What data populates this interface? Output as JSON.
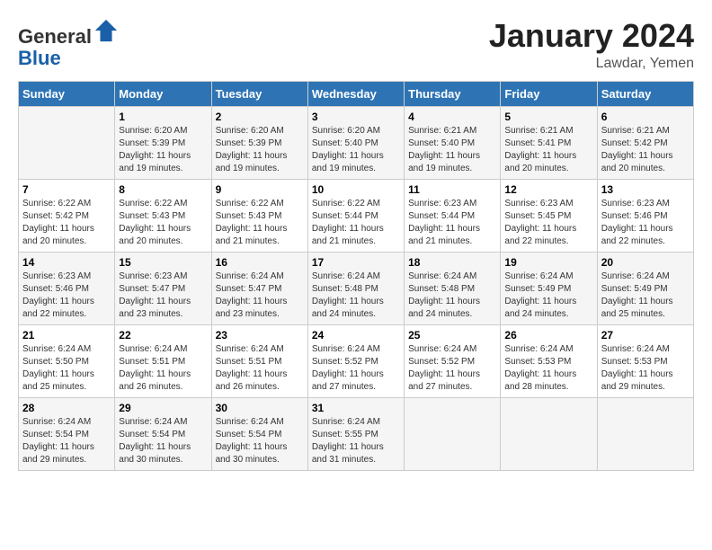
{
  "header": {
    "logo_line1": "General",
    "logo_line2": "Blue",
    "month": "January 2024",
    "location": "Lawdar, Yemen"
  },
  "weekdays": [
    "Sunday",
    "Monday",
    "Tuesday",
    "Wednesday",
    "Thursday",
    "Friday",
    "Saturday"
  ],
  "weeks": [
    [
      {
        "day": "",
        "info": ""
      },
      {
        "day": "1",
        "info": "Sunrise: 6:20 AM\nSunset: 5:39 PM\nDaylight: 11 hours and 19 minutes."
      },
      {
        "day": "2",
        "info": "Sunrise: 6:20 AM\nSunset: 5:39 PM\nDaylight: 11 hours and 19 minutes."
      },
      {
        "day": "3",
        "info": "Sunrise: 6:20 AM\nSunset: 5:40 PM\nDaylight: 11 hours and 19 minutes."
      },
      {
        "day": "4",
        "info": "Sunrise: 6:21 AM\nSunset: 5:40 PM\nDaylight: 11 hours and 19 minutes."
      },
      {
        "day": "5",
        "info": "Sunrise: 6:21 AM\nSunset: 5:41 PM\nDaylight: 11 hours and 20 minutes."
      },
      {
        "day": "6",
        "info": "Sunrise: 6:21 AM\nSunset: 5:42 PM\nDaylight: 11 hours and 20 minutes."
      }
    ],
    [
      {
        "day": "7",
        "info": "Sunrise: 6:22 AM\nSunset: 5:42 PM\nDaylight: 11 hours and 20 minutes."
      },
      {
        "day": "8",
        "info": "Sunrise: 6:22 AM\nSunset: 5:43 PM\nDaylight: 11 hours and 20 minutes."
      },
      {
        "day": "9",
        "info": "Sunrise: 6:22 AM\nSunset: 5:43 PM\nDaylight: 11 hours and 21 minutes."
      },
      {
        "day": "10",
        "info": "Sunrise: 6:22 AM\nSunset: 5:44 PM\nDaylight: 11 hours and 21 minutes."
      },
      {
        "day": "11",
        "info": "Sunrise: 6:23 AM\nSunset: 5:44 PM\nDaylight: 11 hours and 21 minutes."
      },
      {
        "day": "12",
        "info": "Sunrise: 6:23 AM\nSunset: 5:45 PM\nDaylight: 11 hours and 22 minutes."
      },
      {
        "day": "13",
        "info": "Sunrise: 6:23 AM\nSunset: 5:46 PM\nDaylight: 11 hours and 22 minutes."
      }
    ],
    [
      {
        "day": "14",
        "info": "Sunrise: 6:23 AM\nSunset: 5:46 PM\nDaylight: 11 hours and 22 minutes."
      },
      {
        "day": "15",
        "info": "Sunrise: 6:23 AM\nSunset: 5:47 PM\nDaylight: 11 hours and 23 minutes."
      },
      {
        "day": "16",
        "info": "Sunrise: 6:24 AM\nSunset: 5:47 PM\nDaylight: 11 hours and 23 minutes."
      },
      {
        "day": "17",
        "info": "Sunrise: 6:24 AM\nSunset: 5:48 PM\nDaylight: 11 hours and 24 minutes."
      },
      {
        "day": "18",
        "info": "Sunrise: 6:24 AM\nSunset: 5:48 PM\nDaylight: 11 hours and 24 minutes."
      },
      {
        "day": "19",
        "info": "Sunrise: 6:24 AM\nSunset: 5:49 PM\nDaylight: 11 hours and 24 minutes."
      },
      {
        "day": "20",
        "info": "Sunrise: 6:24 AM\nSunset: 5:49 PM\nDaylight: 11 hours and 25 minutes."
      }
    ],
    [
      {
        "day": "21",
        "info": "Sunrise: 6:24 AM\nSunset: 5:50 PM\nDaylight: 11 hours and 25 minutes."
      },
      {
        "day": "22",
        "info": "Sunrise: 6:24 AM\nSunset: 5:51 PM\nDaylight: 11 hours and 26 minutes."
      },
      {
        "day": "23",
        "info": "Sunrise: 6:24 AM\nSunset: 5:51 PM\nDaylight: 11 hours and 26 minutes."
      },
      {
        "day": "24",
        "info": "Sunrise: 6:24 AM\nSunset: 5:52 PM\nDaylight: 11 hours and 27 minutes."
      },
      {
        "day": "25",
        "info": "Sunrise: 6:24 AM\nSunset: 5:52 PM\nDaylight: 11 hours and 27 minutes."
      },
      {
        "day": "26",
        "info": "Sunrise: 6:24 AM\nSunset: 5:53 PM\nDaylight: 11 hours and 28 minutes."
      },
      {
        "day": "27",
        "info": "Sunrise: 6:24 AM\nSunset: 5:53 PM\nDaylight: 11 hours and 29 minutes."
      }
    ],
    [
      {
        "day": "28",
        "info": "Sunrise: 6:24 AM\nSunset: 5:54 PM\nDaylight: 11 hours and 29 minutes."
      },
      {
        "day": "29",
        "info": "Sunrise: 6:24 AM\nSunset: 5:54 PM\nDaylight: 11 hours and 30 minutes."
      },
      {
        "day": "30",
        "info": "Sunrise: 6:24 AM\nSunset: 5:54 PM\nDaylight: 11 hours and 30 minutes."
      },
      {
        "day": "31",
        "info": "Sunrise: 6:24 AM\nSunset: 5:55 PM\nDaylight: 11 hours and 31 minutes."
      },
      {
        "day": "",
        "info": ""
      },
      {
        "day": "",
        "info": ""
      },
      {
        "day": "",
        "info": ""
      }
    ]
  ]
}
